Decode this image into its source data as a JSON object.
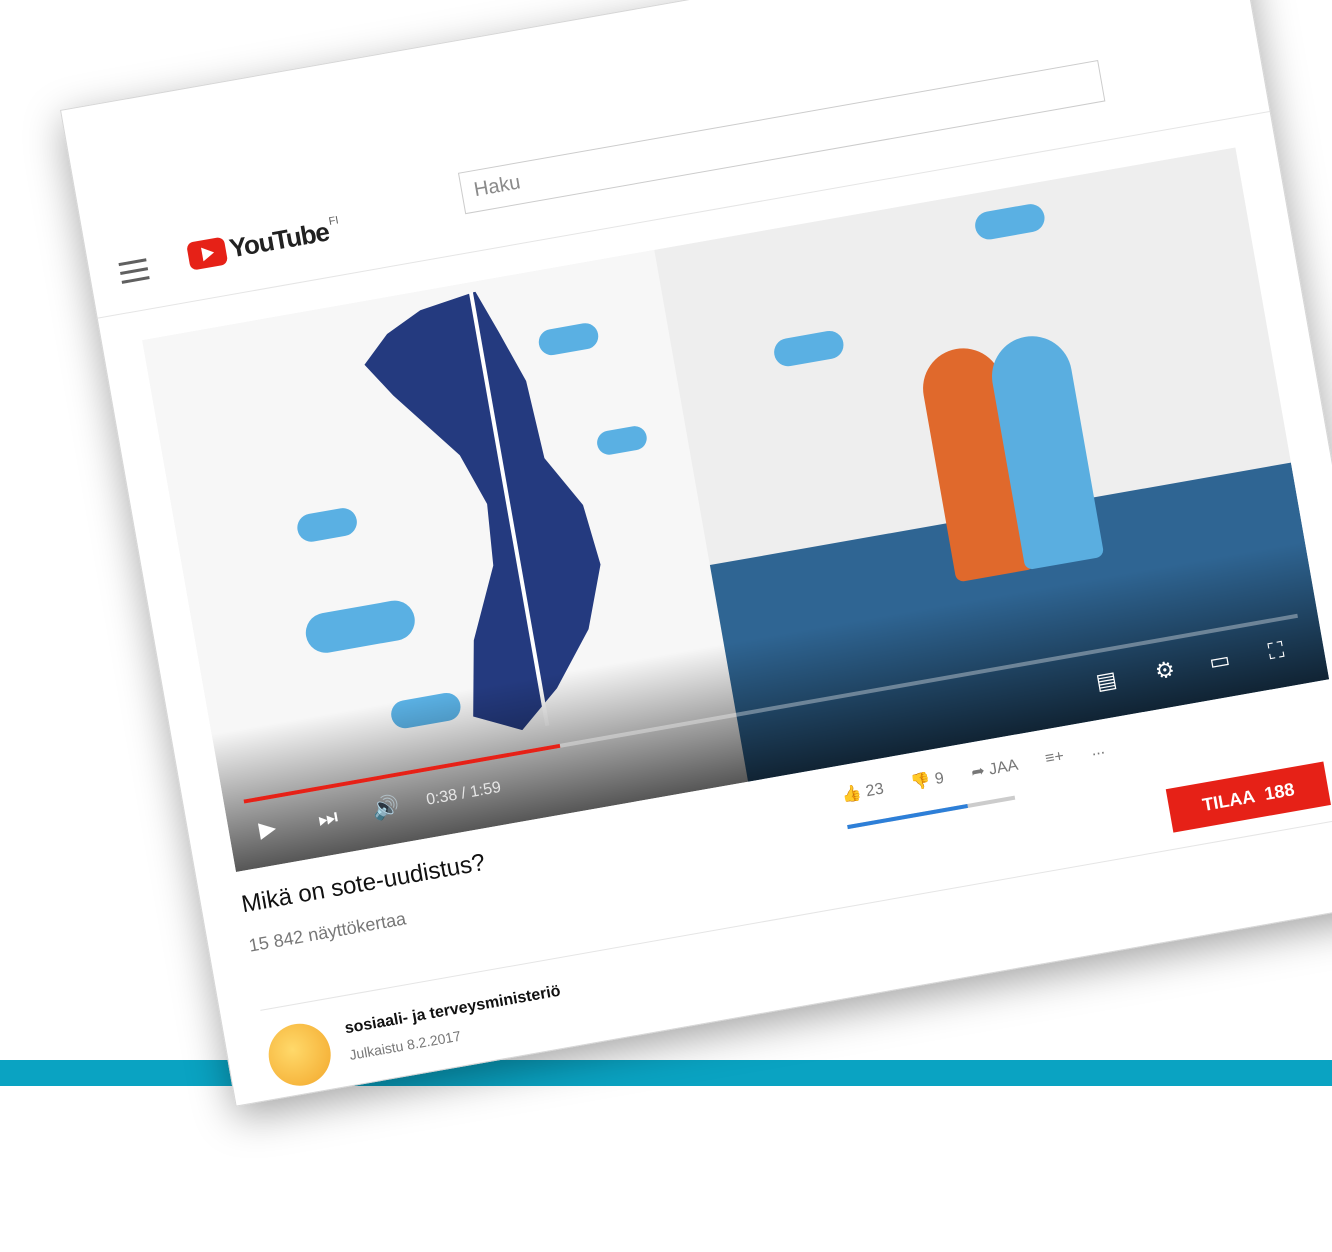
{
  "header": {
    "logo_text": "YouTube",
    "logo_region": "FI",
    "search_placeholder": "Haku"
  },
  "player": {
    "time_label": "0:38 / 1:59",
    "progress": 0.3
  },
  "video": {
    "title": "Mikä on sote-uudistus?",
    "views": "15 842 näyttökertaa",
    "likes": "23",
    "dislikes": "9",
    "share_label": "JAA",
    "more_label": "...",
    "like_ratio": 0.72
  },
  "channel": {
    "name": "sosiaali- ja terveysministeriö",
    "published": "Julkaistu 8.2.2017",
    "subscribe_label": "TILAA",
    "subscriber_count": "188"
  },
  "colors": {
    "brand_red": "#e62117",
    "accent_teal": "#0aa3c2",
    "like_blue": "#2d7fd8"
  }
}
